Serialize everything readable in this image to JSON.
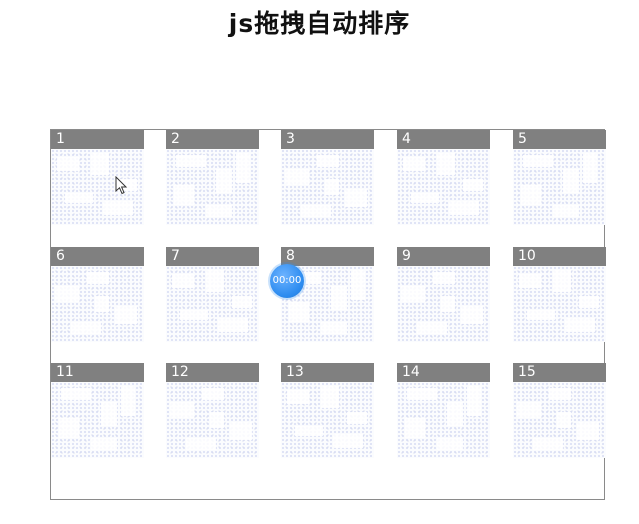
{
  "page": {
    "title": "js拖拽自动排序"
  },
  "board": {
    "cards": [
      {
        "label": "1"
      },
      {
        "label": "2"
      },
      {
        "label": "3"
      },
      {
        "label": "4"
      },
      {
        "label": "5"
      },
      {
        "label": "6"
      },
      {
        "label": "7"
      },
      {
        "label": "8"
      },
      {
        "label": "9"
      },
      {
        "label": "10"
      },
      {
        "label": "11"
      },
      {
        "label": "12"
      },
      {
        "label": "13"
      },
      {
        "label": "14"
      },
      {
        "label": "15"
      }
    ]
  },
  "recorder": {
    "timer_text": "00:00"
  },
  "colors": {
    "card_header": "#808080",
    "timer_bubble": "#2d8cf0"
  },
  "icons": {
    "pointer": "arrow-cursor-icon"
  }
}
